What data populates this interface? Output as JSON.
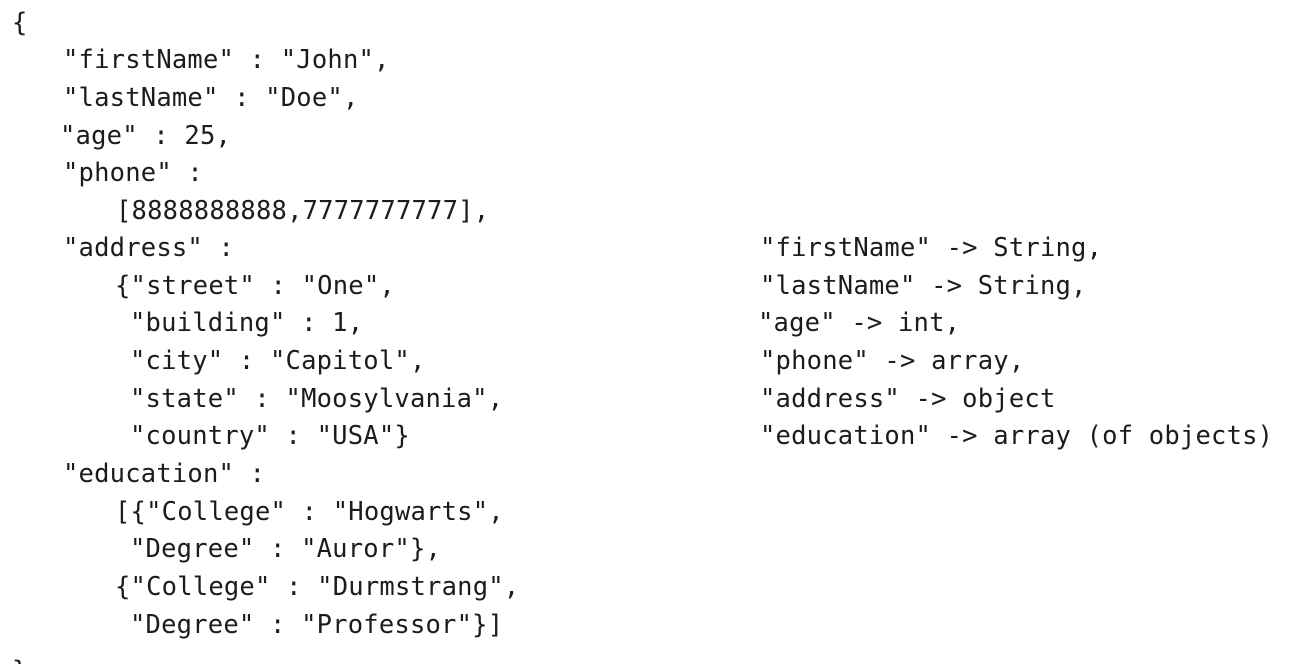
{
  "json_example": {
    "open_brace": "{",
    "first_name_line": "\"firstName\" : \"John\",",
    "last_name_line": "\"lastName\" : \"Doe\",",
    "age_line": "\"age\" : 25,",
    "phone_key_line": "\"phone\" :",
    "phone_value_line": "[8888888888,7777777777],",
    "address_key_line": "\"address\" :",
    "street_line": "{\"street\" : \"One\",",
    "building_line": "\"building\" : 1,",
    "city_line": "\"city\" : \"Capitol\",",
    "state_line": "\"state\" : \"Moosylvania\",",
    "country_line": "\"country\" : \"USA\"}",
    "education_key_line": "\"education\" :",
    "college1_line": "[{\"College\" : \"Hogwarts\",",
    "degree1_line": "\"Degree\" : \"Auror\"},",
    "college2_line": "{\"College\" : \"Durmstrang\",",
    "degree2_line": "\"Degree\" : \"Professor\"}]",
    "close_brace": "}"
  },
  "type_mapping": [
    "\"firstName\" -> String,",
    "\"lastName\" -> String,",
    "\"age\" -> int,",
    "\"phone\" -> array,",
    "\"address\" -> object",
    "\"education\" -> array (of objects)"
  ]
}
